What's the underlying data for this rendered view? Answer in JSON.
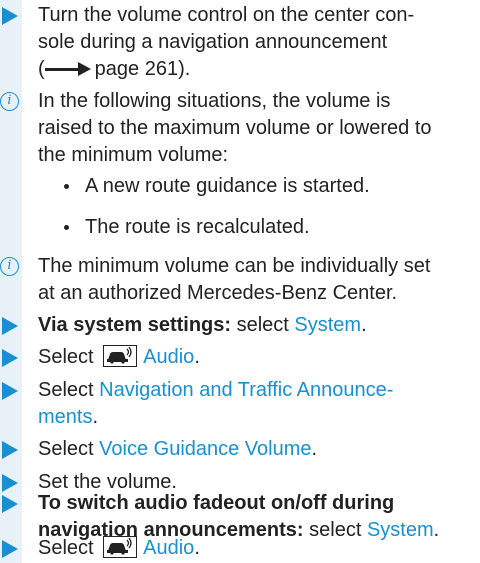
{
  "lines": {
    "s1_l1": "Turn the volume control on the center con-",
    "s1_l2": "sole during a navigation announcement",
    "s1_l3_pre": "(",
    "s1_l3_post": "page 261).",
    "i1_l1": "In the following situations, the volume is",
    "i1_l2": "raised to the maximum volume or lowered to",
    "i1_l3": "the minimum volume:",
    "b1": "A new route guidance is started.",
    "b2": "The route is recalculated.",
    "i2_l1": "The minimum volume can be individually set",
    "i2_l2": "at an authorized Mercedes-Benz Center.",
    "s2_bold": "Via system settings:",
    "s2_rest": " select ",
    "s2_link": "System",
    "s2_end": ".",
    "s3_pre": "Select ",
    "s3_link": "Audio",
    "s3_end": ".",
    "s4_pre": "Select ",
    "s4_link1": "Navigation and Traffic Announce-",
    "s4_link2": "ments",
    "s4_end": ".",
    "s5_pre": "Select ",
    "s5_link": "Voice Guidance Volume",
    "s5_end": ".",
    "s6": "Set the volume.",
    "s7_bold1": "To switch audio fadeout on/off during",
    "s7_bold2": "navigation announcements:",
    "s7_rest": " select ",
    "s7_link": "System",
    "s7_end": ".",
    "s8_pre": "Select ",
    "s8_link": "Audio",
    "s8_end": "."
  },
  "icons": {
    "step": "triangle-step-icon",
    "info": "info-icon",
    "info_glyph": "i",
    "audio": "car-audio-icon",
    "arrow": "right-arrow-icon"
  },
  "colors": {
    "accent": "#1a8fd0",
    "shade": "#e9f1f8",
    "text": "#222222"
  }
}
